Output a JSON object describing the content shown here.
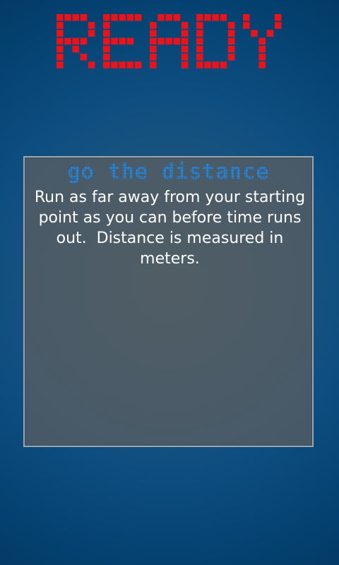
{
  "header": {
    "title": "READY",
    "title_color": "#e8141c"
  },
  "panel": {
    "mode_title": "go the distance",
    "mode_title_color": "#1e88e5",
    "description": "Run as far away from your starting point as you can before time runs out.  Distance is measured in meters."
  }
}
